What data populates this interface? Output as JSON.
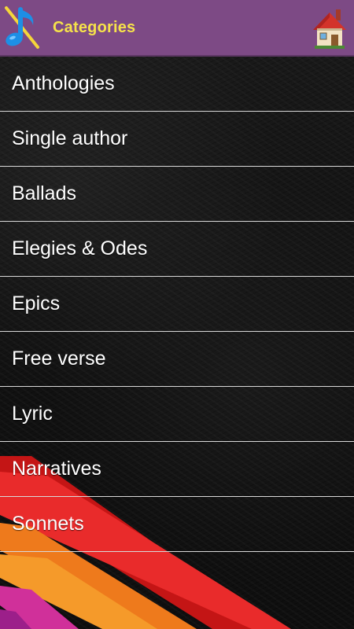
{
  "header": {
    "title": "Categories",
    "app_icon": "music-note-icon",
    "home_icon": "house-icon",
    "background_color": "#7d4a85",
    "title_color": "#f6e24a"
  },
  "categories": [
    {
      "label": "Anthologies"
    },
    {
      "label": "Single author"
    },
    {
      "label": "Ballads"
    },
    {
      "label": "Elegies & Odes"
    },
    {
      "label": "Epics"
    },
    {
      "label": "Free verse"
    },
    {
      "label": "Lyric"
    },
    {
      "label": "Narratives"
    },
    {
      "label": "Sonnets"
    }
  ],
  "colors": {
    "divider": "#d9d9d9",
    "stripe_red": "#e01b1b",
    "stripe_orange": "#f07a1a",
    "stripe_magenta": "#d0309a"
  }
}
